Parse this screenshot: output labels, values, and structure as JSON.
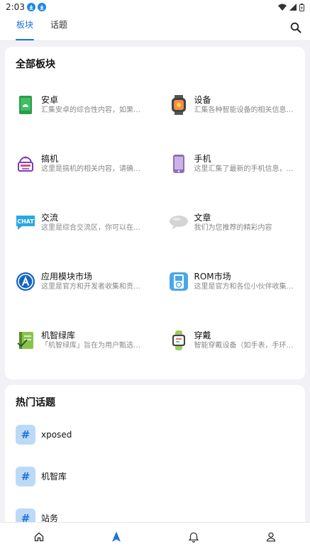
{
  "status": {
    "time": "2:03"
  },
  "tabs": [
    {
      "label": "板块",
      "active": true
    },
    {
      "label": "话题",
      "active": false
    }
  ],
  "sections": {
    "title": "全部板块",
    "items": [
      {
        "name": "安卓",
        "desc": "汇集安卓的综合性内容，如果…",
        "icon": "android-icon"
      },
      {
        "name": "设备",
        "desc": "汇集各种智能设备的相关信息…",
        "icon": "smartwatch-icon"
      },
      {
        "name": "搞机",
        "desc": "这里是搞机的相关内容，请确…",
        "icon": "robot-icon"
      },
      {
        "name": "手机",
        "desc": "这里汇集了最新的手机信息，…",
        "icon": "phone-icon"
      },
      {
        "name": "交流",
        "desc": "这里是综合交流区，你可以在…",
        "icon": "chat-icon"
      },
      {
        "name": "文章",
        "desc": "我们为您推荐的精彩内容",
        "icon": "speech-bubble-icon"
      },
      {
        "name": "应用模块市场",
        "desc": "这里是官方和开发者收集和贡…",
        "icon": "app-store-icon"
      },
      {
        "name": "ROM市场",
        "desc": "这里是官方和各位小伙伴收集…",
        "icon": "ipod-icon"
      },
      {
        "name": "机智绿库",
        "desc": "「机智绿库」旨在为用户甄选…",
        "icon": "notebook-icon"
      },
      {
        "name": "穿戴",
        "desc": "智能穿戴设备（如手表，手环…",
        "icon": "fitness-band-icon"
      }
    ]
  },
  "topics": {
    "title": "热门话题",
    "items": [
      {
        "name": "xposed",
        "icon": "#"
      },
      {
        "name": "机智库",
        "icon": "#"
      },
      {
        "name": "站务",
        "icon": "#"
      }
    ]
  },
  "colors": {
    "accent": "#1e73d8",
    "background": "#f2f2f6"
  }
}
